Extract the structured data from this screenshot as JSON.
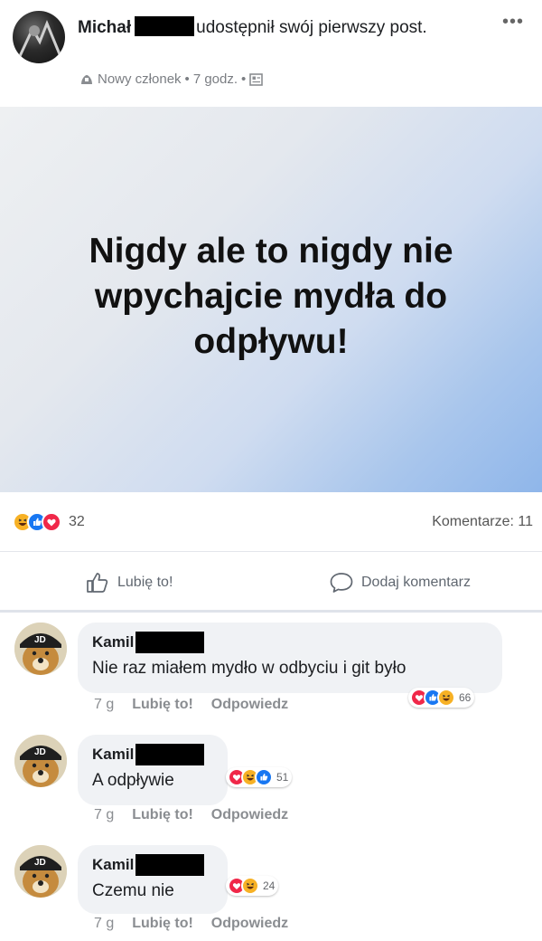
{
  "post": {
    "author_name": "Michał",
    "author_action": "udostępnił swój pierwszy post.",
    "meta_badge": "Nowy członek",
    "meta_time": "7 godz.",
    "more_label": "•••",
    "text": "Nigdy ale to nigdy nie wpychajcie mydła do odpływu!"
  },
  "stats": {
    "reaction_count": "32",
    "comments_label": "Komentarze: 11"
  },
  "actions": {
    "like_label": "Lubię to!",
    "comment_label": "Dodaj komentarz"
  },
  "comments": [
    {
      "name": "Kamil",
      "avatar_text": "JD",
      "text": "Nie raz miałem mydło w odbyciu i git było",
      "time": "7 g",
      "like_label": "Lubię to!",
      "reply_label": "Odpowiedz",
      "reaction_count": "66"
    },
    {
      "name": "Kamil",
      "avatar_text": "JD",
      "text": "A odpływie",
      "time": "7 g",
      "like_label": "Lubię to!",
      "reply_label": "Odpowiedz",
      "reaction_count": "51"
    },
    {
      "name": "Kamil",
      "avatar_text": "JD",
      "text": "Czemu nie",
      "time": "7 g",
      "like_label": "Lubię to!",
      "reply_label": "Odpowiedz",
      "reaction_count": "24"
    }
  ],
  "colors": {
    "like_blue": "#1877f2",
    "love_red": "#f02849",
    "haha_yellow": "#f7b125",
    "muted_text": "#8a8d91"
  },
  "icons": [
    "like-reaction-icon",
    "love-reaction-icon",
    "haha-reaction-icon",
    "thumbs-up-icon",
    "comment-bubble-icon",
    "public-globe-icon",
    "new-member-icon"
  ]
}
